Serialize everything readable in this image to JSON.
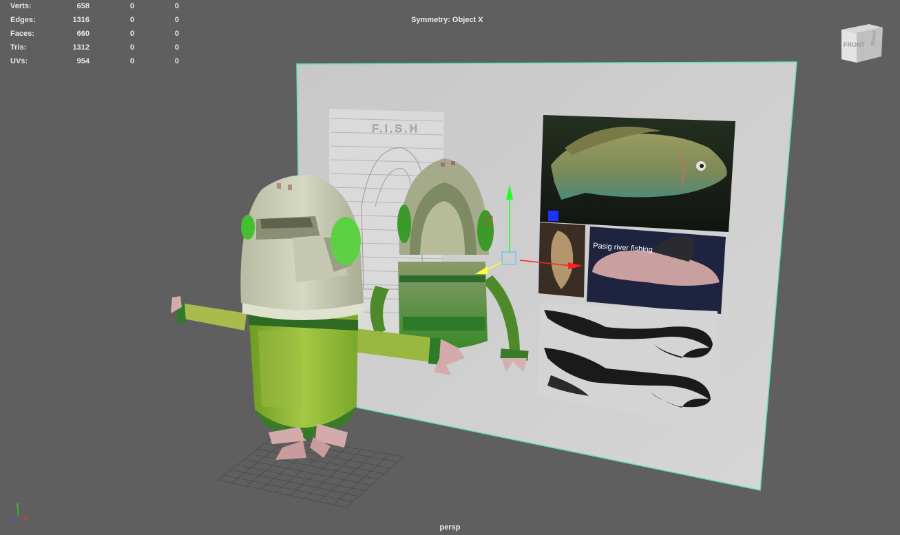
{
  "hud": {
    "stats": [
      {
        "label": "Verts:",
        "v1": "658",
        "v2": "0",
        "v3": "0"
      },
      {
        "label": "Edges:",
        "v1": "1316",
        "v2": "0",
        "v3": "0"
      },
      {
        "label": "Faces:",
        "v1": "660",
        "v2": "0",
        "v3": "0"
      },
      {
        "label": "Tris:",
        "v1": "1312",
        "v2": "0",
        "v3": "0"
      },
      {
        "label": "UVs:",
        "v1": "954",
        "v2": "0",
        "v3": "0"
      }
    ],
    "symmetry": "Symmetry: Object X",
    "camera": "persp"
  },
  "view_cube": {
    "face_front": "FRONT",
    "face_right": "RIGHT"
  },
  "image_plane": {
    "sketch_title": "F.I.S.H",
    "photo_caption": "Pasig river fishing"
  },
  "axis_indicator": {
    "y": "y",
    "x": "x",
    "z": "z"
  },
  "colors": {
    "background": "#5f5f5f",
    "selection_outline": "#5ee6a8",
    "robot_green": "#8ab830",
    "robot_helmet": "#c9ccb2",
    "manip_x": "#ff2020",
    "manip_y": "#20ff20",
    "manip_z": "#2030ff"
  }
}
